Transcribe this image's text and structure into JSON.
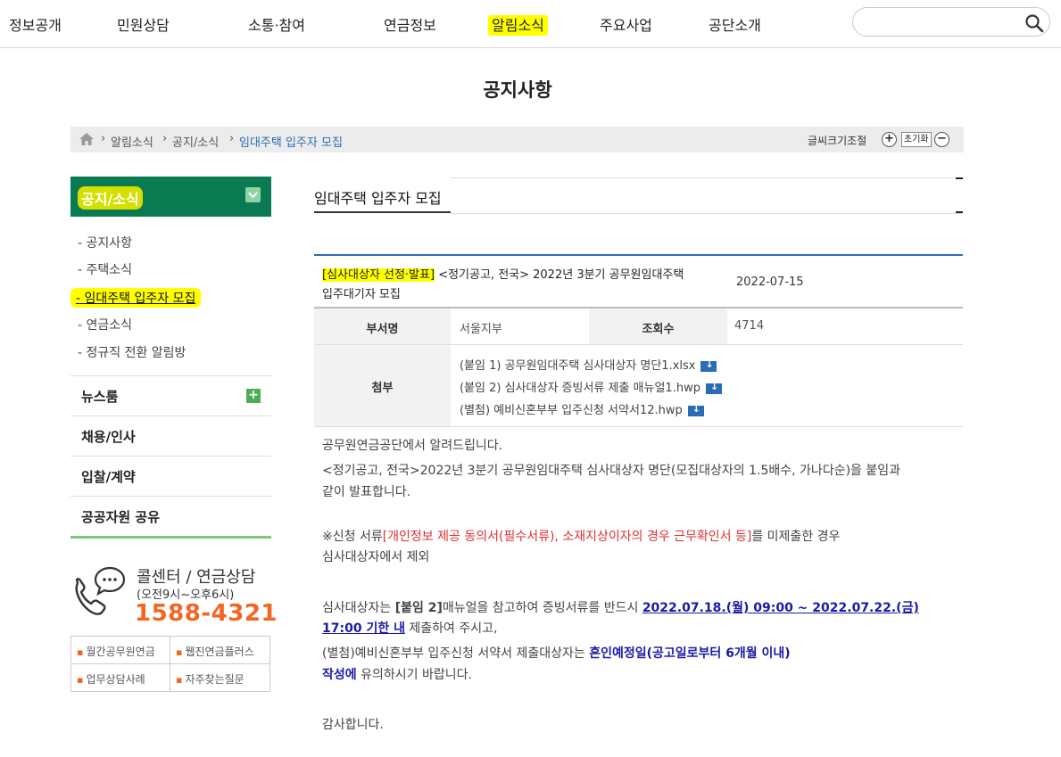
{
  "nav": {
    "items": [
      "정보공개",
      "민원상담",
      "소통·참여",
      "연금정보",
      "알림소식",
      "주요사업",
      "공단소개"
    ],
    "search_placeholder": ""
  },
  "page_title": "공지사항",
  "breadcrumb": {
    "items": [
      "알림소식",
      "공지/소식",
      "임대주택 입주자 모집"
    ],
    "font_size_label": "글씨크기조절",
    "plus": "+",
    "reset": "초기화",
    "minus": "−"
  },
  "sidebar": {
    "section_title": "공지/소식",
    "sub_items": [
      "- 공지사항",
      "- 주택소식",
      "- 임대주택 입주자 모집",
      "- 연금소식",
      "- 정규직 전환 알림방"
    ],
    "menus": [
      "뉴스룸",
      "채용/인사",
      "입찰/계약",
      "공공자원 공유"
    ],
    "plus": "+"
  },
  "callcenter": {
    "title": "콜센터 / 연금상담",
    "hours": "(오전9시~오후6시)",
    "number": "1588-4321"
  },
  "quicklinks": [
    "월간공무원연금",
    "웹진연금플러스",
    "업무상담사례",
    "자주찾는질문"
  ],
  "main": {
    "tab_title": "임대주택 입주자 모집",
    "post": {
      "tag": "[심사대상자 선정·발표]",
      "title_rest": " <정기공고, 전국> 2022년 3분기 공무원임대주택",
      "title_line2": "입주대기자 모집",
      "date": "2022-07-15"
    },
    "meta": {
      "dept_label": "부서명",
      "dept_value": "서울지부",
      "views_label": "조회수",
      "views_value": "4714",
      "attach_label": "첨부"
    },
    "attachments": [
      "(붙임 1) 공무원임대주택 심사대상자 명단1.xlsx",
      "(붙임 2) 심사대상자 증빙서류 제출 매뉴얼1.hwp",
      "(별첨) 예비신혼부부 입주신청 서약서12.hwp"
    ],
    "body": {
      "p1": "공무원연금공단에서 알려드립니다.",
      "p2a": "<정기공고, 전국>2022년 3분기 공무원임대주택 심사대상자 명단(모집대상자의 1.5배수, 가나다순)을 붙임과",
      "p2b": "같이 발표합니다.",
      "p3a_pre": "※신청 서류",
      "p3a_red": "[개인정보 제공 동의서(필수서류), 소재지상이자의 경우 근무확인서 등]",
      "p3a_post": "를 미제출한 경우",
      "p3b": "심사대상자에서 제외",
      "p4a_pre": "심사대상자는 ",
      "p4a_bold": "[붙임 2]",
      "p4a_mid": "매뉴얼을 참고하여 증빙서류를 반드시 ",
      "p4a_blue": "2022.07.18.(월) 09:00 ~ 2022.07.22.(금)",
      "p4b_blue": "17:00 기한 내",
      "p4b_post": " 제출하여 주시고,",
      "p5a_pre": "(별첨)예비신혼부부 입주신청 서약서 제출대상자는 ",
      "p5a_blue": "혼인예정일(공고일로부터 6개월 이내)",
      "p5b_blue": "작성에",
      "p5b_post": " 유의하시기 바랍니다.",
      "p6": "감사합니다."
    }
  },
  "colors": {
    "accent_green": "#0a7a52",
    "link_blue": "#2a6db5",
    "highlight": "#ffff00",
    "phone_orange": "#f26522",
    "notice_red": "#e03030"
  }
}
